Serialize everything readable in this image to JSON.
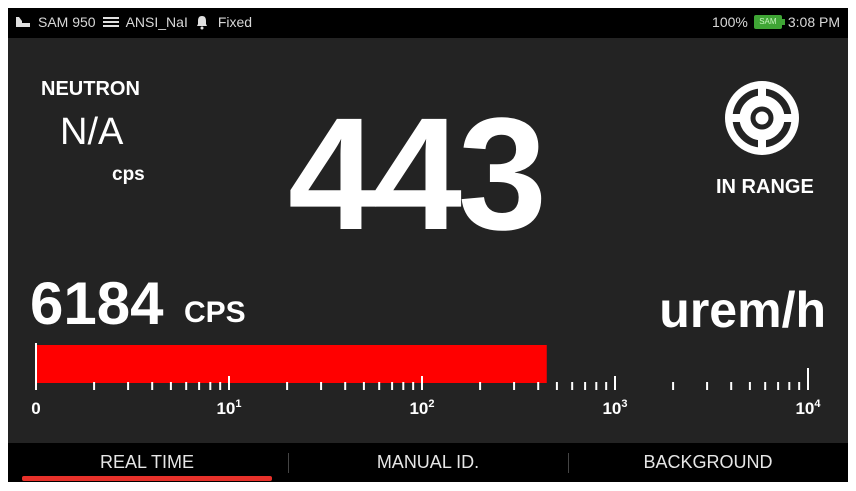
{
  "status_bar": {
    "device": "SAM 950",
    "detector": "ANSI_NaI",
    "mode": "Fixed",
    "battery_percent": "100%",
    "battery_badge": "SAM",
    "time": "3:08 PM"
  },
  "neutron": {
    "title": "NEUTRON",
    "value": "N/A",
    "unit": "cps"
  },
  "dose_rate": {
    "value": "443",
    "unit": "urem/h"
  },
  "range_status": {
    "label": "IN RANGE"
  },
  "count_rate": {
    "value": "6184",
    "unit": "CPS"
  },
  "gauge": {
    "scale": "log",
    "current_value": 443,
    "min": 1,
    "max": 10000,
    "tick_labels": [
      {
        "base": "0",
        "exp": ""
      },
      {
        "base": "10",
        "exp": "1"
      },
      {
        "base": "10",
        "exp": "2"
      },
      {
        "base": "10",
        "exp": "3"
      },
      {
        "base": "10",
        "exp": "4"
      }
    ],
    "bar_color": "#ff0000"
  },
  "tabs": [
    {
      "label": "REAL TIME",
      "active": true
    },
    {
      "label": "MANUAL ID.",
      "active": false
    },
    {
      "label": "BACKGROUND",
      "active": false
    }
  ],
  "colors": {
    "background": "#232323",
    "status_bar": "#000000",
    "active_tab_indicator": "#e8312a"
  }
}
